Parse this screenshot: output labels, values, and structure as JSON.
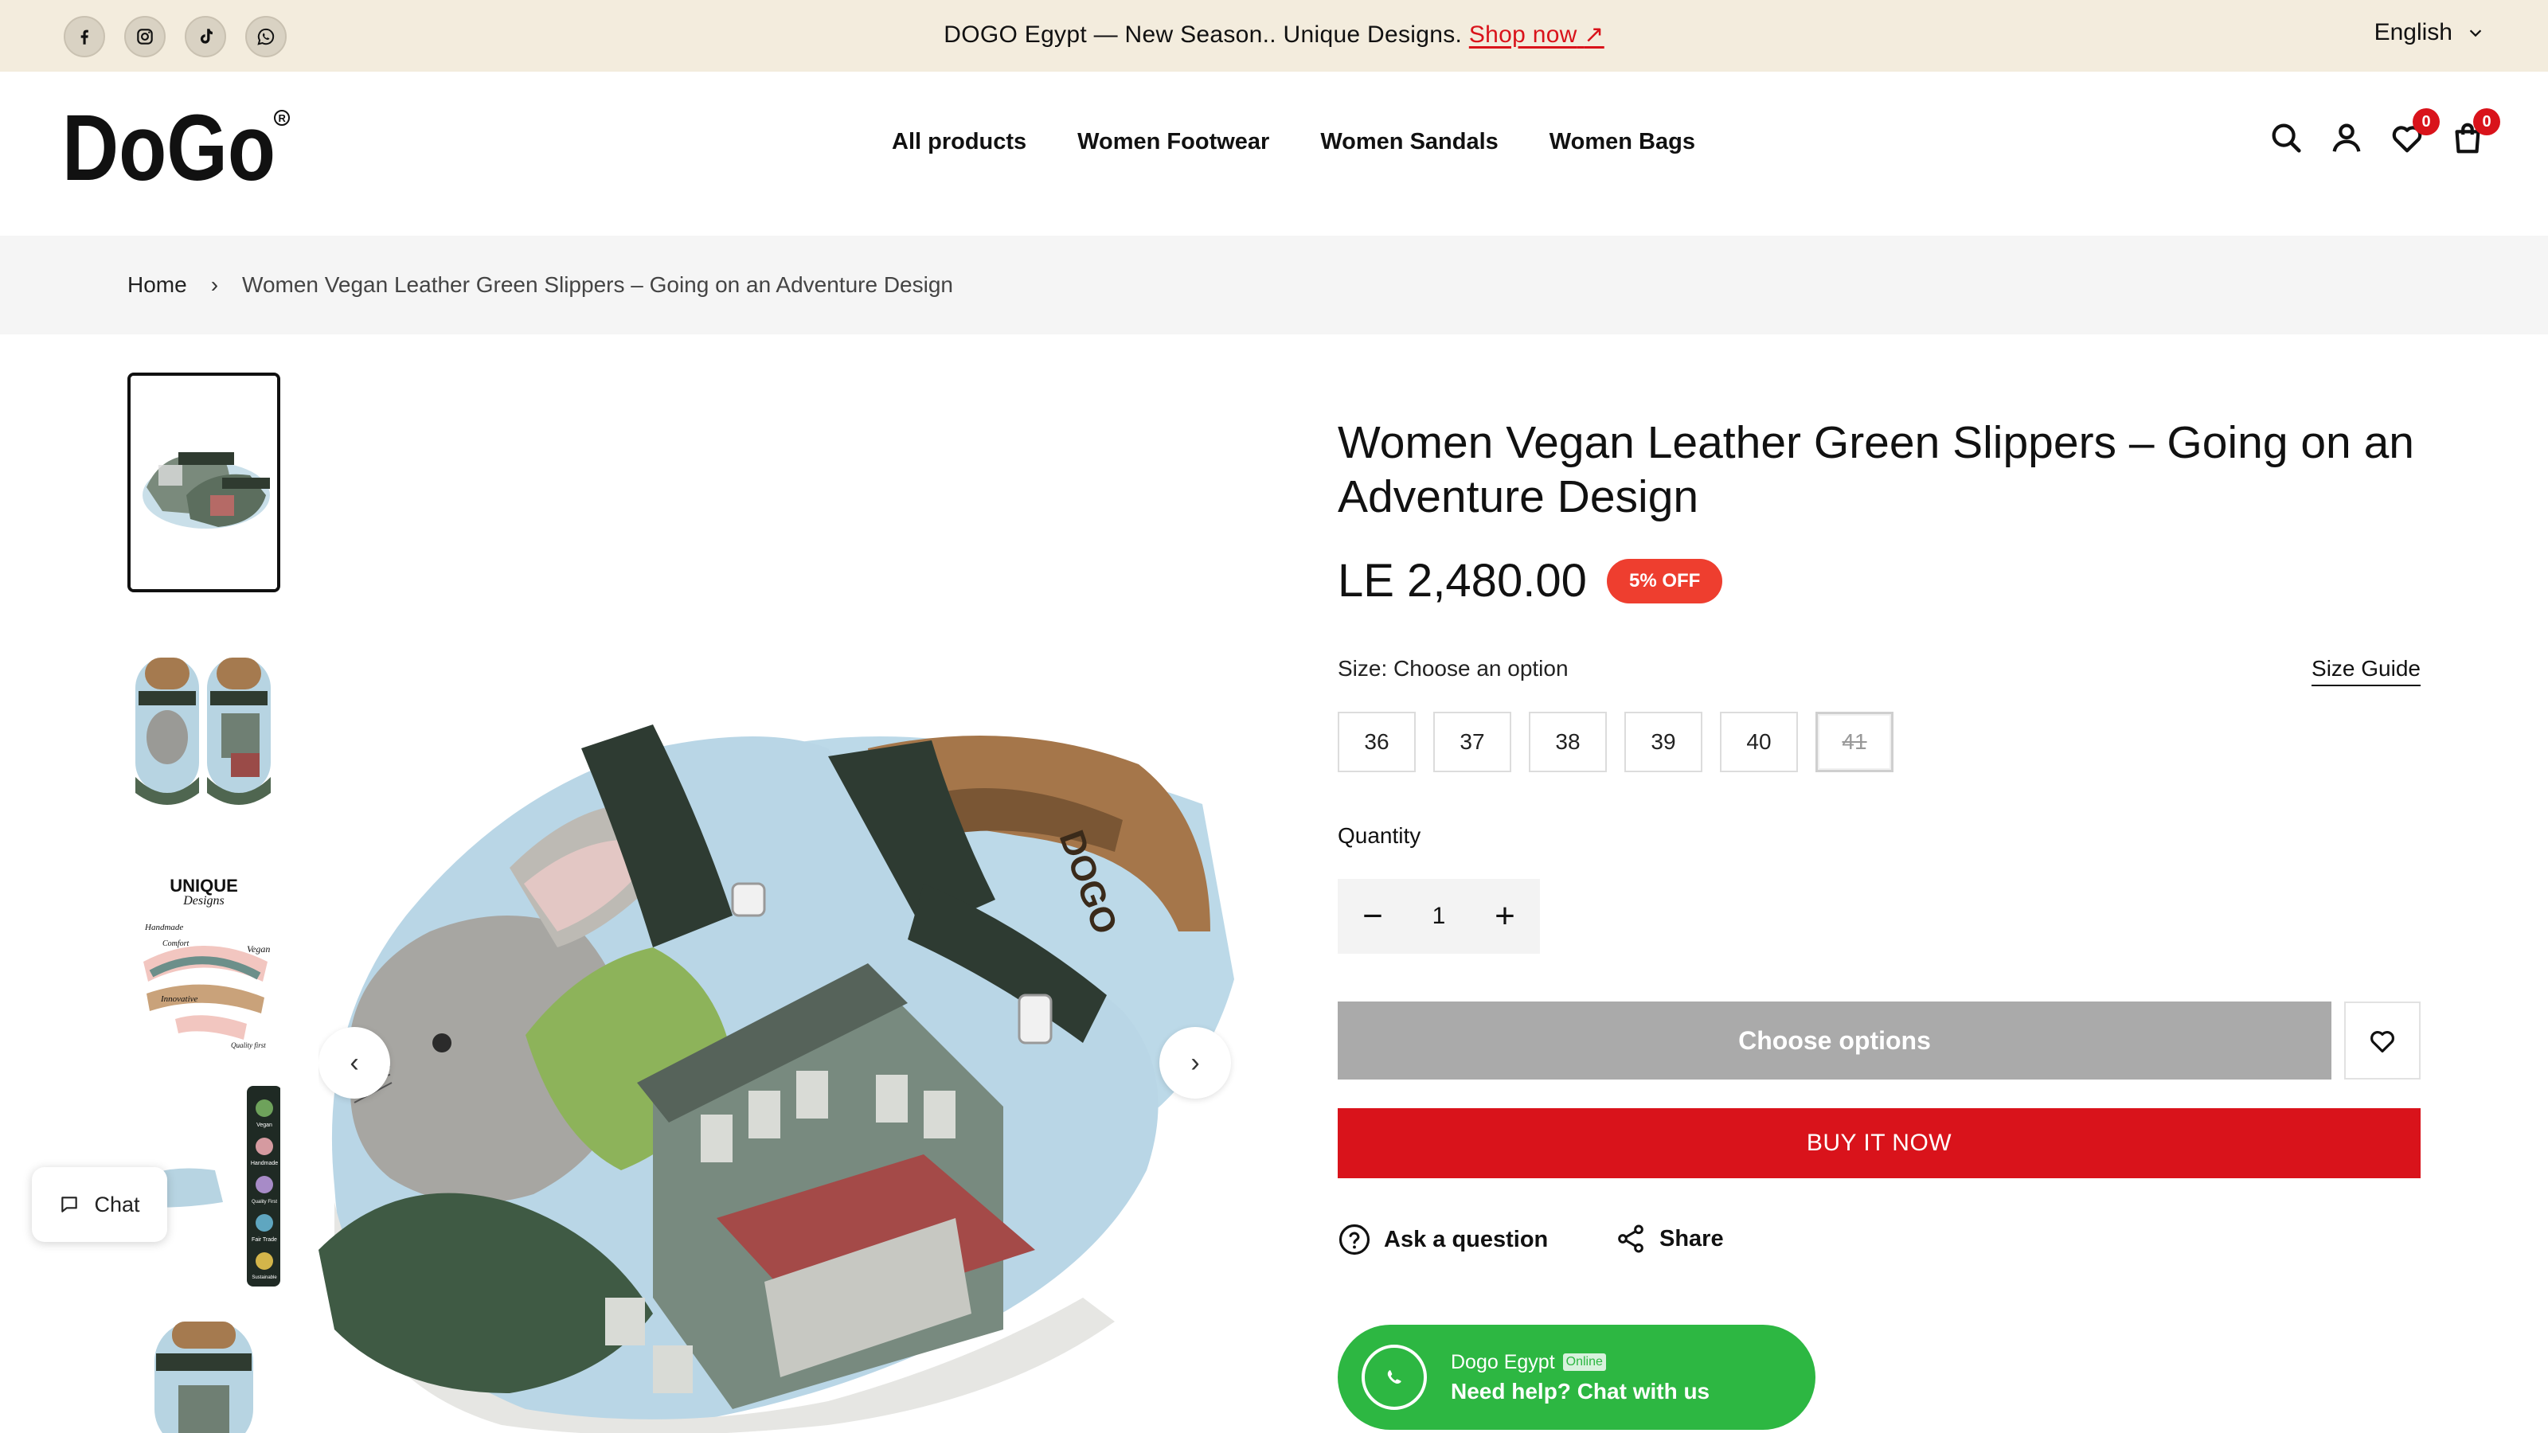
{
  "announcement": {
    "text": "DOGO Egypt — New Season.. Unique Designs.",
    "link": "Shop now",
    "link_arrow": "↗",
    "language": "English"
  },
  "social_icons": [
    "facebook-icon",
    "instagram-icon",
    "tiktok-icon",
    "whatsapp-icon"
  ],
  "header": {
    "logo_text": "DoGo",
    "nav": [
      "All products",
      "Women Footwear",
      "Women Sandals",
      "Women Bags"
    ],
    "wishlist_count": "0",
    "cart_count": "0"
  },
  "breadcrumb": {
    "home": "Home",
    "separator": "›",
    "current": "Women Vegan Leather Green Slippers – Going on an Adventure Design"
  },
  "product": {
    "title": "Women Vegan Leather Green Slippers – Going on an Adventure Design",
    "price": "LE 2,480.00",
    "discount_badge": "5% OFF",
    "size_label": "Size: Choose an option",
    "size_guide": "Size Guide",
    "sizes": [
      "36",
      "37",
      "38",
      "39",
      "40",
      "41"
    ],
    "unavailable_sizes": [
      "41"
    ],
    "quantity_label": "Quantity",
    "quantity": "1",
    "choose_button": "Choose options",
    "buy_button": "BUY IT NOW",
    "ask_question": "Ask a question",
    "share": "Share"
  },
  "thumbnails": {
    "count": 5,
    "active_index": 0,
    "infographic_words": [
      "UNIQUE",
      "Designs",
      "Handmade",
      "Comfort",
      "Vegan",
      "Innovative",
      "Quality first"
    ],
    "icon_strip_words": [
      "Vegan",
      "Handmade",
      "Quality First",
      "Fair Trade",
      "Sustainable"
    ]
  },
  "chat_widget": {
    "label": "Chat"
  },
  "whatsapp": {
    "name": "Dogo Egypt",
    "status": "Online",
    "help": "Need help? Chat with us"
  },
  "colors": {
    "announcement_bg": "#f3ecdd",
    "accent_red": "#d9131b",
    "badge_orange": "#ee3e2f",
    "disabled_button": "#aaaaaa",
    "whatsapp_green": "#2db742"
  }
}
